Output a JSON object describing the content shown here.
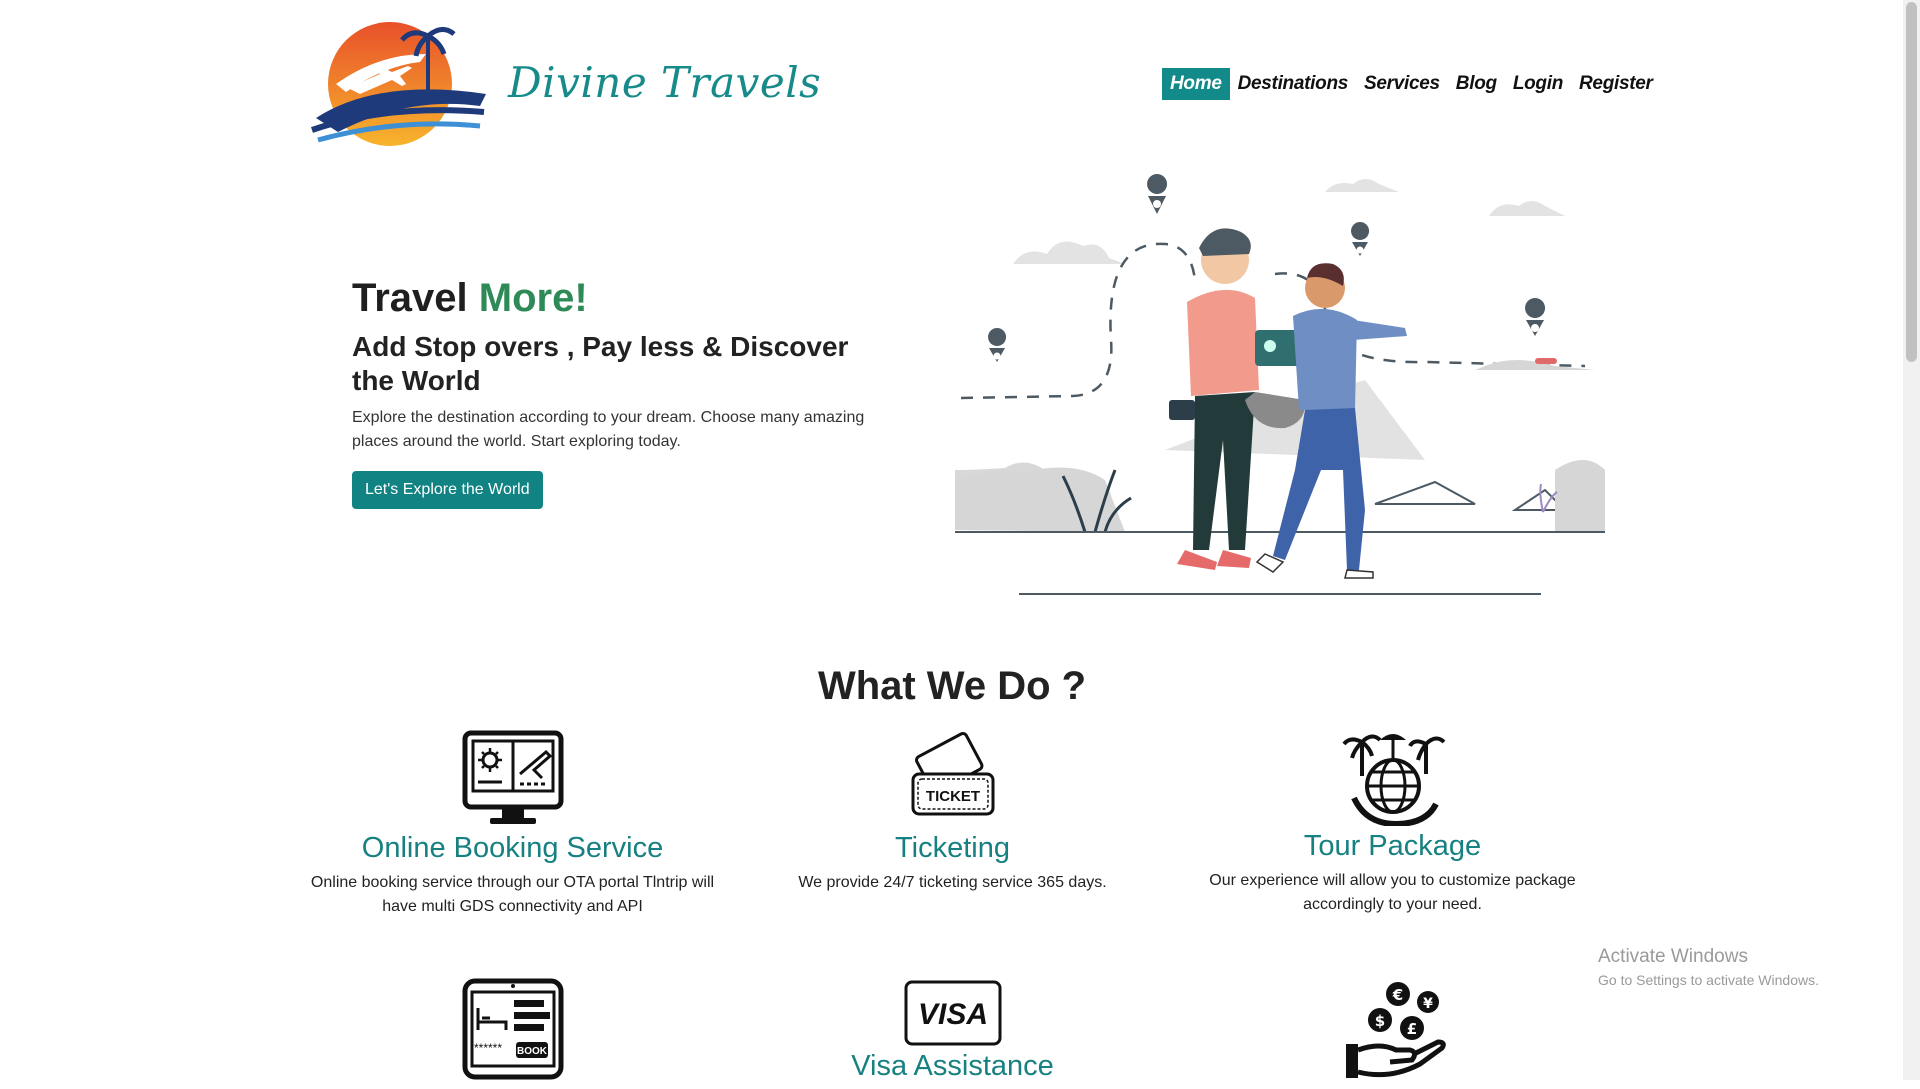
{
  "header": {
    "brand": "Divine Travels",
    "nav": [
      "Home",
      "Destinations",
      "Services",
      "Blog",
      "Login",
      "Register"
    ],
    "active_nav": "Home"
  },
  "hero": {
    "title_plain": "Travel",
    "title_accent": "More!",
    "subtitle": "Add Stop overs , Pay less & Discover the World",
    "description": "Explore the destination according to your dream. Choose many amazing places around the world. Start exploring today.",
    "button": "Let's Explore the World"
  },
  "what_we_do": {
    "title": "What We Do ?",
    "cards": [
      {
        "title": "Online Booking Service",
        "text": "Online booking service through our OTA portal Tlntrip will have multi GDS connectivity and API",
        "icon": "booking-monitor-icon"
      },
      {
        "title": "Ticketing",
        "text": "We provide 24/7 ticketing service 365 days.",
        "icon": "ticket-icon"
      },
      {
        "title": "Tour Package",
        "text": "Our experience will allow you to customize package accordingly to your need.",
        "icon": "globe-palm-icon"
      },
      {
        "title": "",
        "text": "",
        "icon": "hotel-booking-tablet-icon"
      },
      {
        "title": "Visa Assistance",
        "text": "",
        "icon": "visa-icon"
      },
      {
        "title": "",
        "text": "",
        "icon": "currency-hand-icon"
      }
    ]
  },
  "icon_text": {
    "ticket": "TICKET",
    "visa": "VISA",
    "book": "BOOK"
  },
  "watermark": {
    "line1": "Activate Windows",
    "line2": "Go to Settings to activate Windows."
  },
  "colors": {
    "brand_teal": "#128a8a",
    "accent_green": "#2e8b57",
    "logo_orange": "#f39a1e",
    "logo_navy": "#1f3a7a"
  }
}
